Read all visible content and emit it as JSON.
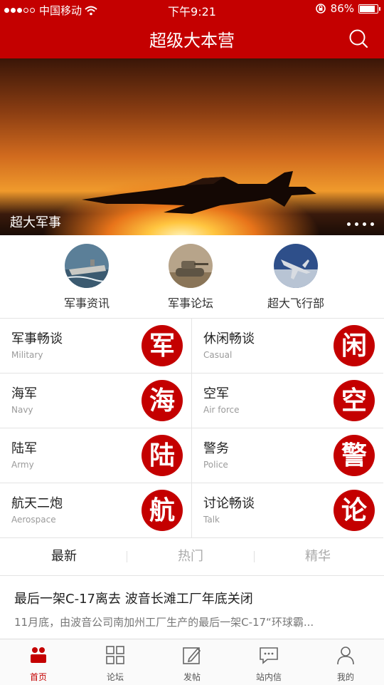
{
  "status_bar": {
    "carrier": "中国移动",
    "time": "下午9:21",
    "battery": "86%"
  },
  "header": {
    "title": "超级大本营",
    "search_icon": "search-icon"
  },
  "banner": {
    "caption": "超大军事",
    "page_count": 4
  },
  "shortcuts": [
    {
      "label": "军事资讯",
      "icon": "aircraft-carrier-thumbnail"
    },
    {
      "label": "军事论坛",
      "icon": "tank-thumbnail"
    },
    {
      "label": "超大飞行部",
      "icon": "fighter-jet-thumbnail"
    }
  ],
  "categories": [
    {
      "cn": "军事畅谈",
      "en": "Military",
      "badge": "军"
    },
    {
      "cn": "休闲畅谈",
      "en": "Casual",
      "badge": "闲"
    },
    {
      "cn": "海军",
      "en": "Navy",
      "badge": "海"
    },
    {
      "cn": "空军",
      "en": "Air force",
      "badge": "空"
    },
    {
      "cn": "陆军",
      "en": "Army",
      "badge": "陆"
    },
    {
      "cn": "警务",
      "en": "Police",
      "badge": "警"
    },
    {
      "cn": "航天二炮",
      "en": "Aerospace",
      "badge": "航"
    },
    {
      "cn": "讨论畅谈",
      "en": "Talk",
      "badge": "论"
    }
  ],
  "feed_tabs": [
    {
      "label": "最新",
      "active": true
    },
    {
      "label": "热门",
      "active": false
    },
    {
      "label": "精华",
      "active": false
    }
  ],
  "article": {
    "headline": "最后一架C-17离去 波音长滩工厂年底关闭",
    "summary": "11月底，由波音公司南加州工厂生产的最后一架C-17“环球霸..."
  },
  "bottom_nav": [
    {
      "label": "首页",
      "icon": "home-icon",
      "active": true
    },
    {
      "label": "论坛",
      "icon": "grid-icon",
      "active": false
    },
    {
      "label": "发帖",
      "icon": "compose-icon",
      "active": false
    },
    {
      "label": "站内信",
      "icon": "message-icon",
      "active": false
    },
    {
      "label": "我的",
      "icon": "profile-icon",
      "active": false
    }
  ],
  "colors": {
    "brand_red": "#c40000"
  }
}
